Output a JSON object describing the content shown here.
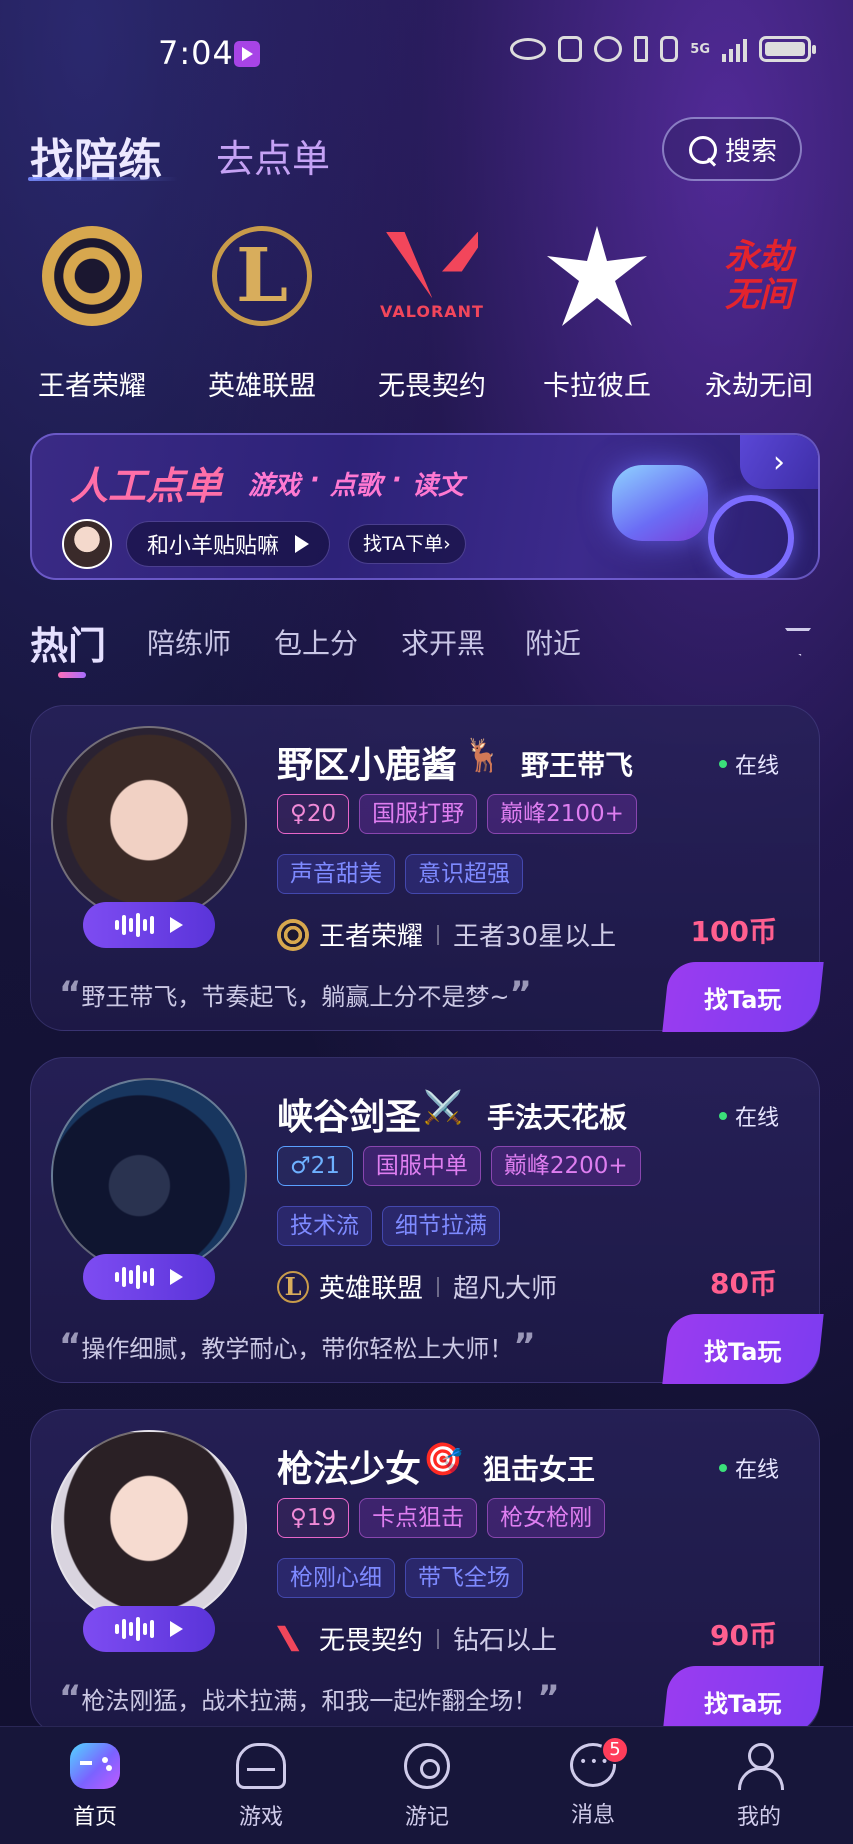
{
  "status_bar": {
    "time": "7:04",
    "network": "5G"
  },
  "header": {
    "tab_active": "找陪练",
    "tab_other": "去点单",
    "search_label": "搜索"
  },
  "games": [
    {
      "name": "王者荣耀",
      "icon": "honor-of-kings-logo"
    },
    {
      "name": "英雄联盟",
      "icon": "league-of-legends-logo"
    },
    {
      "name": "无畏契约",
      "icon": "valorant-logo",
      "logo_text": "VALORANT"
    },
    {
      "name": "卡拉彼丘",
      "icon": "strinova-logo"
    },
    {
      "name": "永劫无间",
      "icon": "naraka-logo",
      "logo_text": "永劫无间"
    }
  ],
  "banner": {
    "title": "人工点单",
    "tags": [
      "游戏",
      "点歌",
      "读文"
    ],
    "user_name": "和小羊贴贴嘛",
    "find_label": "找TA下单›",
    "arrow": "›"
  },
  "categories": [
    "热门",
    "陪练师",
    "包上分",
    "求开黑",
    "附近"
  ],
  "cards": [
    {
      "name": "野区小鹿酱",
      "emoji": "🦌",
      "title": "野王带飞",
      "status": "在线",
      "gender_age": "♀20",
      "gender": "female",
      "tags1": [
        "国服打野",
        "巅峰2100+"
      ],
      "tags2": [
        "声音甜美",
        "意识超强"
      ],
      "game": "王者荣耀",
      "rank": "王者30星以上",
      "price": "100币",
      "quote": "野王带飞，节奏起飞，躺赢上分不是梦~",
      "cta": "找Ta玩"
    },
    {
      "name": "峡谷剑圣",
      "emoji": "⚔️",
      "title": "手法天花板",
      "status": "在线",
      "gender_age": "♂21",
      "gender": "male",
      "tags1": [
        "国服中单",
        "巅峰2200+"
      ],
      "tags2": [
        "技术流",
        "细节拉满"
      ],
      "game": "英雄联盟",
      "rank": "超凡大师",
      "price": "80币",
      "quote": "操作细腻，教学耐心，带你轻松上大师！",
      "cta": "找Ta玩"
    },
    {
      "name": "枪法少女",
      "emoji": "🎯",
      "title": "狙击女王",
      "status": "在线",
      "gender_age": "♀19",
      "gender": "female",
      "tags1": [
        "卡点狙击",
        "枪女枪刚"
      ],
      "tags2": [
        "枪刚心细",
        "带飞全场"
      ],
      "game": "无畏契约",
      "rank": "钻石以上",
      "price": "90币",
      "quote": "枪法刚猛，战术拉满，和我一起炸翻全场！",
      "cta": "找Ta玩"
    }
  ],
  "tabbar": [
    {
      "label": "首页",
      "icon": "home-gamepad-icon",
      "active": true
    },
    {
      "label": "游戏",
      "icon": "game-helmet-icon"
    },
    {
      "label": "游记",
      "icon": "travel-icon"
    },
    {
      "label": "消息",
      "icon": "message-icon",
      "badge": "5"
    },
    {
      "label": "我的",
      "icon": "profile-icon"
    }
  ],
  "colors": {
    "accent": "#7d3cf0",
    "price": "#ff5f8f",
    "online": "#3be07a"
  }
}
